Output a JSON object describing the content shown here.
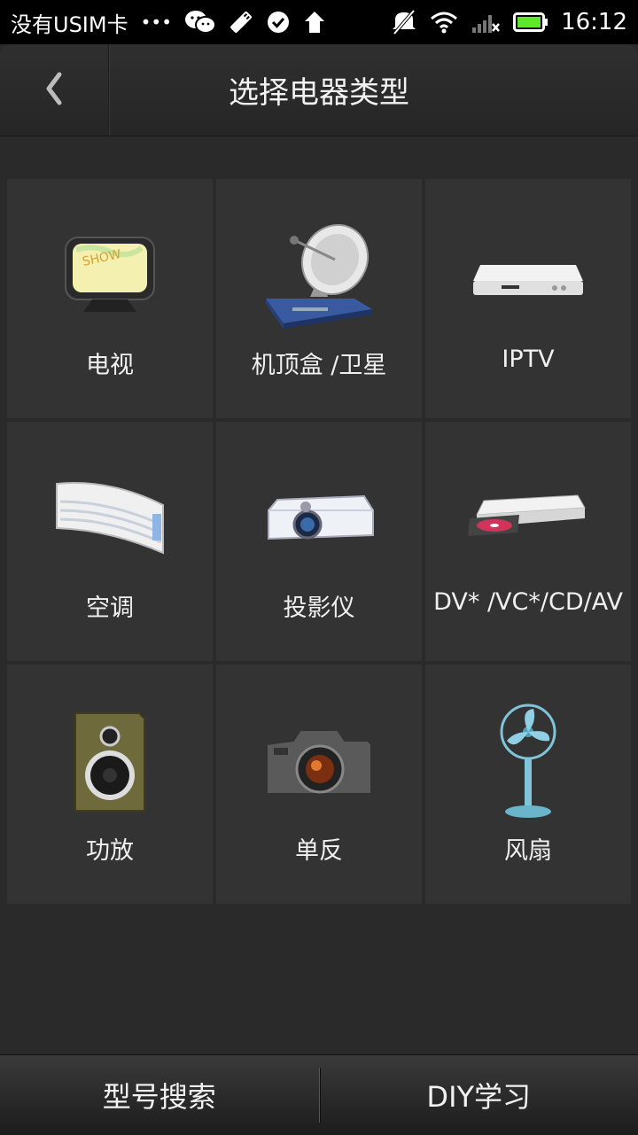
{
  "status_bar": {
    "carrier": "没有USIM卡",
    "dots": "•••",
    "time": "16:12",
    "icons": [
      "wechat-icon",
      "usb-icon",
      "check-circle-icon",
      "upload-arrow-icon",
      "mute-icon",
      "wifi-icon",
      "signal-icon",
      "battery-icon"
    ]
  },
  "header": {
    "back_icon": "chevron-left-icon",
    "title": "选择电器类型"
  },
  "devices": [
    {
      "label": "电视",
      "icon": "tv-icon"
    },
    {
      "label": "机顶盒 /卫星",
      "icon": "satellite-dish-icon"
    },
    {
      "label": "IPTV",
      "icon": "iptv-box-icon"
    },
    {
      "label": "空调",
      "icon": "air-conditioner-icon"
    },
    {
      "label": "投影仪",
      "icon": "projector-icon"
    },
    {
      "label": "DV* /VC*/CD/AV",
      "icon": "dvd-player-icon"
    },
    {
      "label": "功放",
      "icon": "speaker-icon"
    },
    {
      "label": "单反",
      "icon": "camera-icon"
    },
    {
      "label": "风扇",
      "icon": "fan-icon"
    }
  ],
  "bottom_bar": {
    "model_search": "型号搜索",
    "diy_learn": "DIY学习"
  },
  "colors": {
    "background": "#2a2a2a",
    "tile": "#333333",
    "status_bar": "#000000",
    "battery": "#5ee82c"
  }
}
